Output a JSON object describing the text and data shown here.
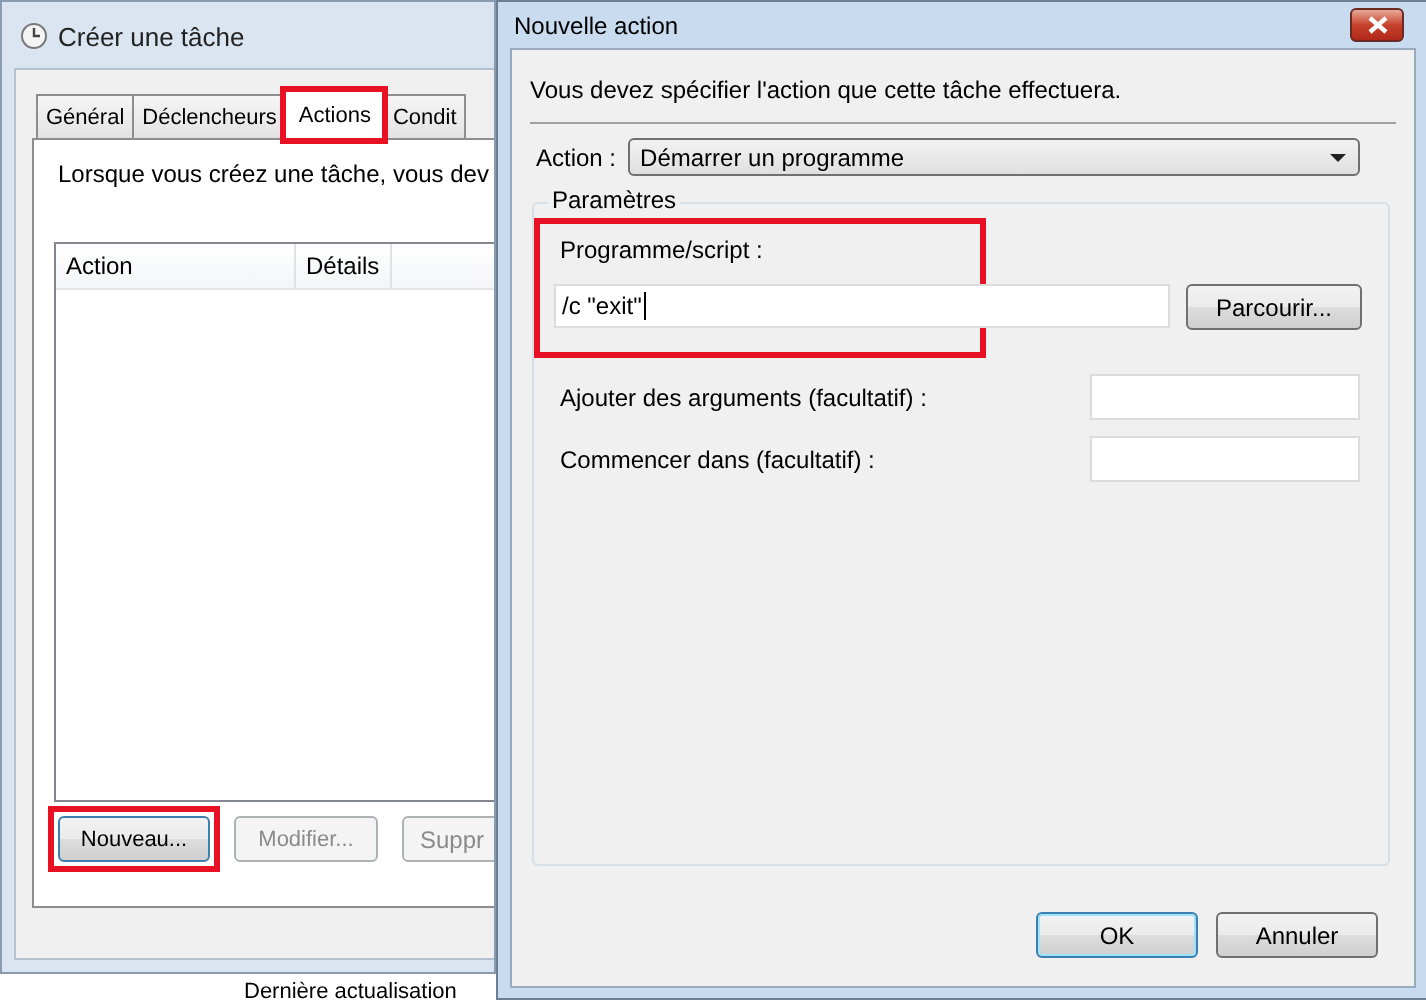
{
  "back_window": {
    "title": "Créer une tâche",
    "tabs": [
      {
        "label": "Général",
        "selected": false,
        "highlighted": false
      },
      {
        "label": "Déclencheurs",
        "selected": false,
        "highlighted": false
      },
      {
        "label": "Actions",
        "selected": true,
        "highlighted": true
      },
      {
        "label": "Condit",
        "selected": false,
        "highlighted": false
      }
    ],
    "intro": "Lorsque vous créez une tâche, vous dev",
    "table": {
      "columns": [
        "Action",
        "Détails"
      ]
    },
    "buttons": [
      {
        "label": "Nouveau...",
        "disabled": false,
        "highlighted": true
      },
      {
        "label": "Modifier...",
        "disabled": true,
        "highlighted": false
      },
      {
        "label": "Suppr",
        "disabled": true,
        "highlighted": false
      }
    ],
    "behind_text": "Dernière actualisation"
  },
  "dialog": {
    "title": "Nouvelle action",
    "instruction": "Vous devez spécifier l'action que cette tâche effectuera.",
    "action_label": "Action :",
    "action_value": "Démarrer un programme",
    "group_title": "Paramètres",
    "program": {
      "label": "Programme/script :",
      "value": "/c \"exit\"",
      "highlighted": true
    },
    "browse_button": "Parcourir...",
    "fields": [
      {
        "label": "Ajouter des arguments (facultatif) :"
      },
      {
        "label": "Commencer dans (facultatif) :"
      }
    ],
    "buttons": [
      {
        "label": "OK",
        "default": true
      },
      {
        "label": "Annuler",
        "default": false
      }
    ]
  }
}
